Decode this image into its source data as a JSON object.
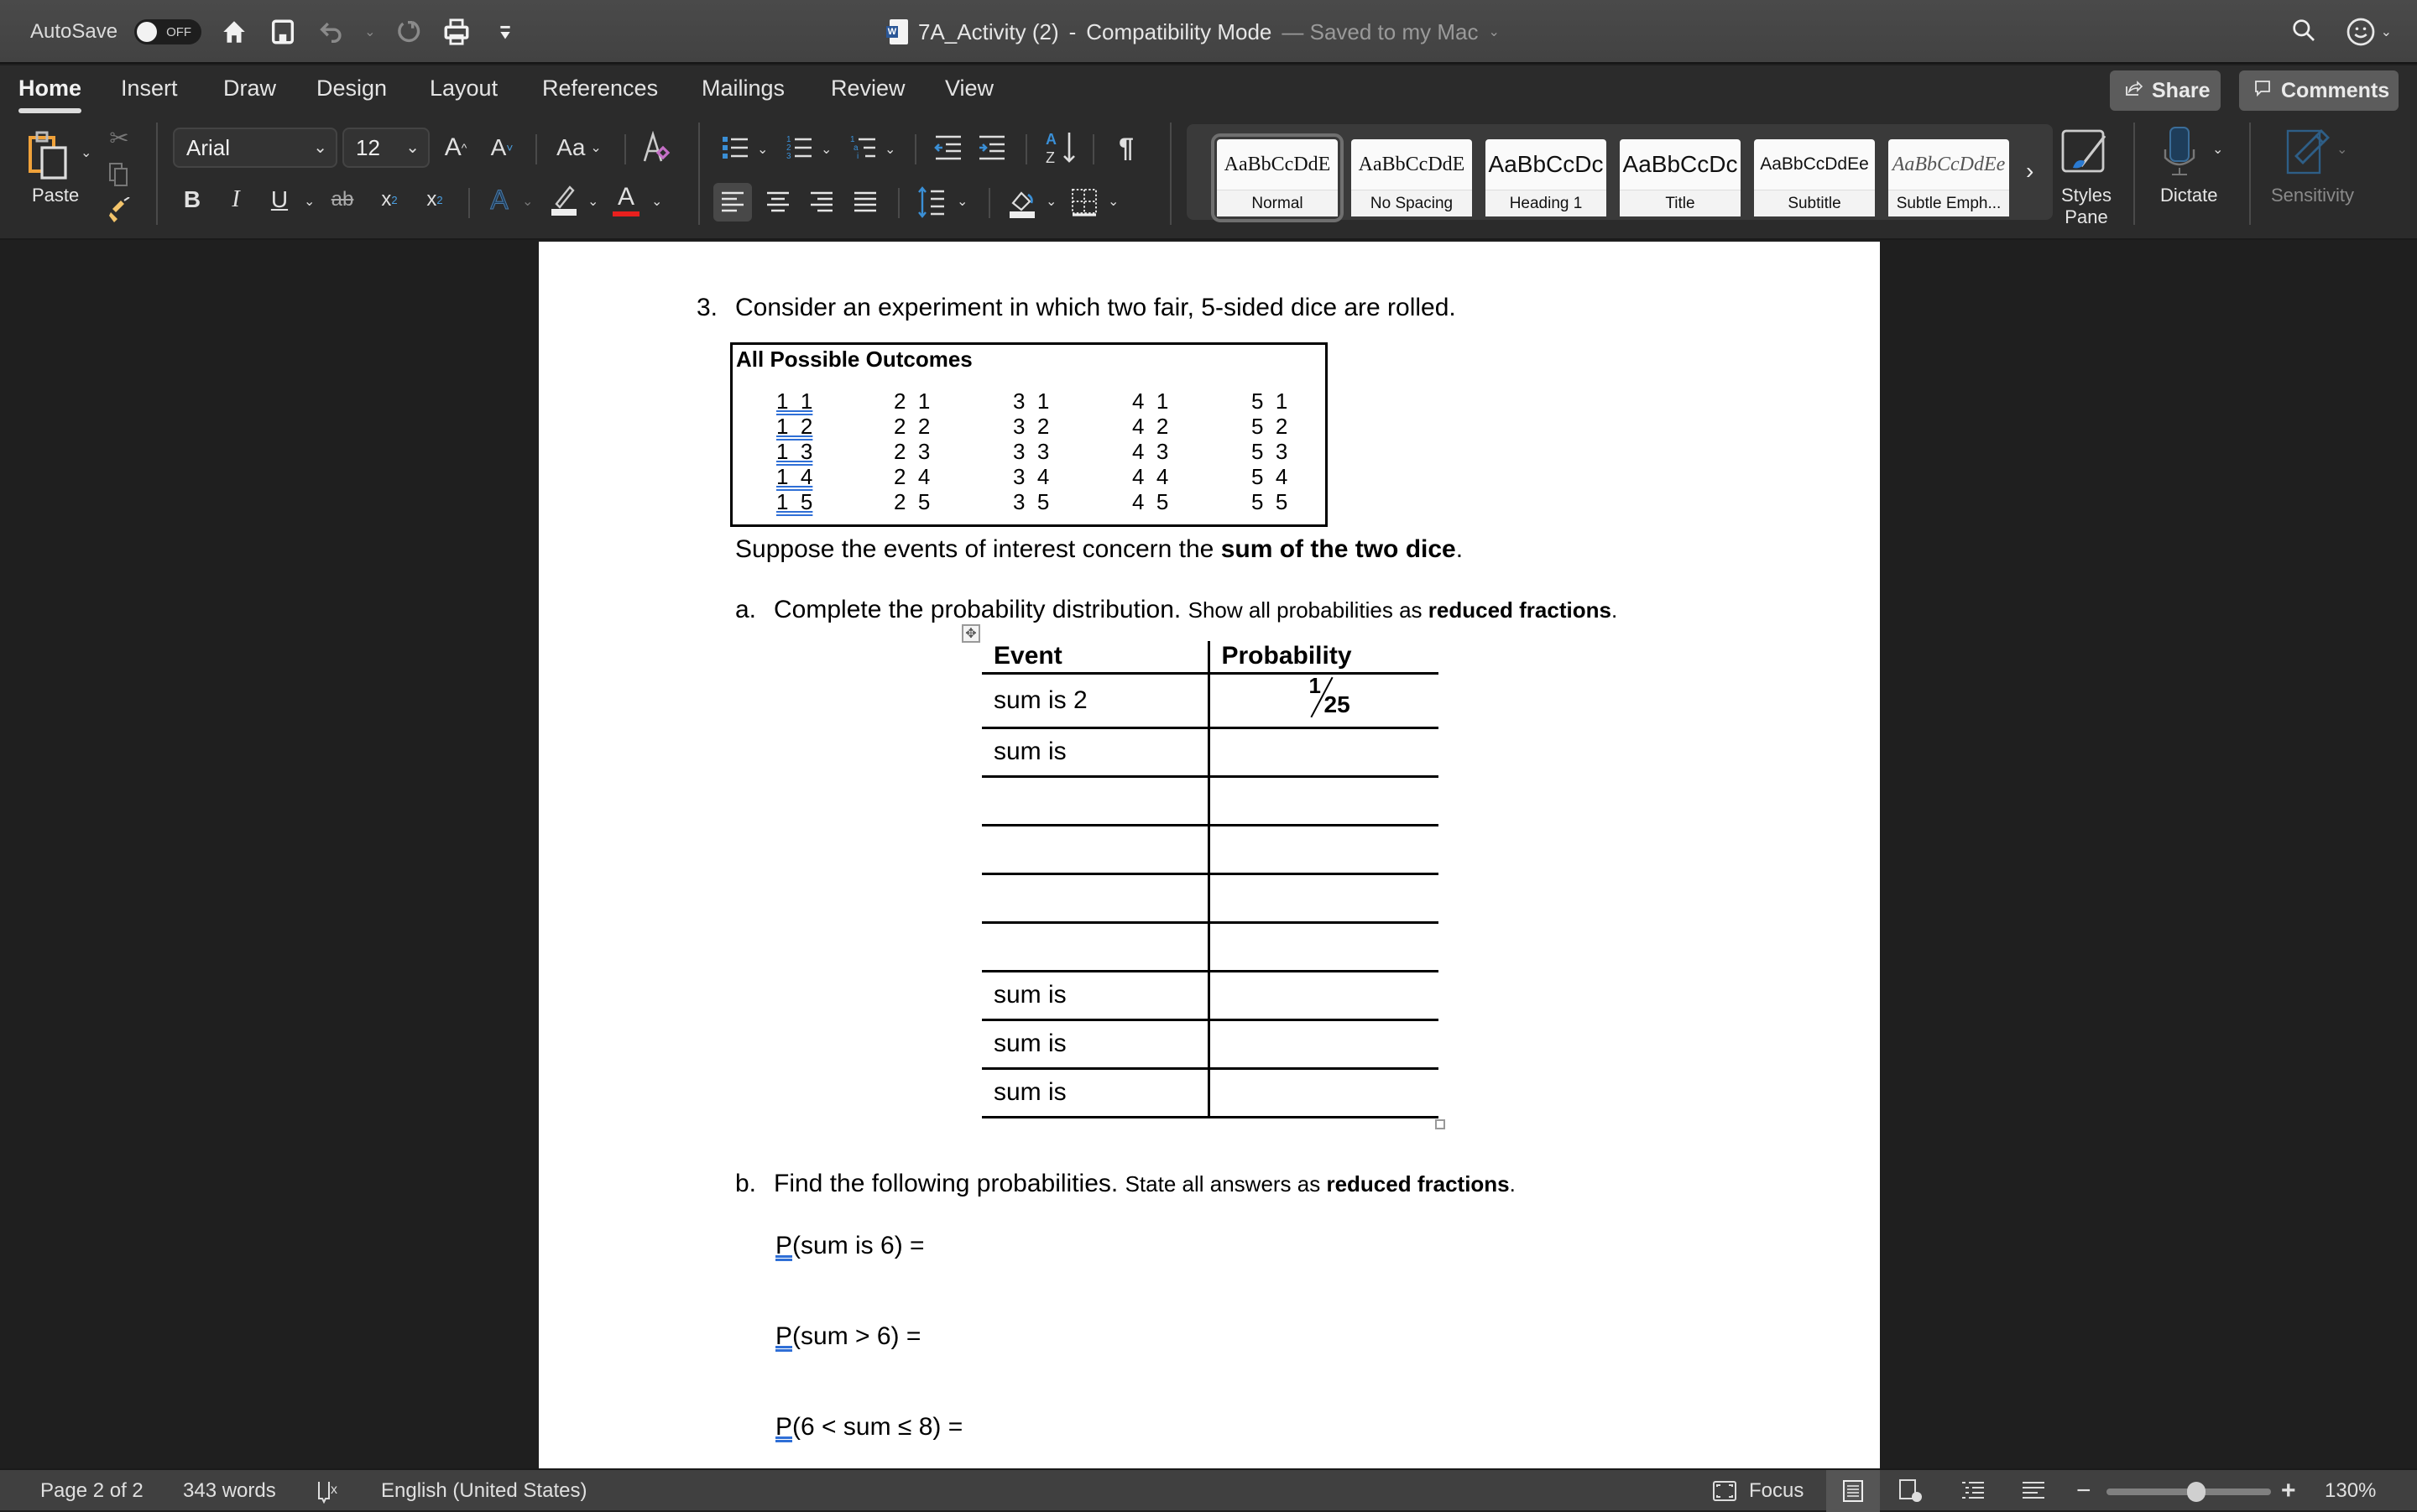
{
  "titlebar": {
    "autosave_label": "AutoSave",
    "autosave_state": "OFF",
    "doc_title": "7A_Activity (2)",
    "separator": "-",
    "mode": "Compatibility Mode",
    "saved_status": "— Saved to my Mac",
    "quick_access": [
      "home-icon",
      "save-icon",
      "undo-icon",
      "redo-icon",
      "print-icon",
      "customize-icon"
    ]
  },
  "ribbon_tabs": [
    {
      "label": "Home",
      "active": true
    },
    {
      "label": "Insert"
    },
    {
      "label": "Draw"
    },
    {
      "label": "Design"
    },
    {
      "label": "Layout"
    },
    {
      "label": "References"
    },
    {
      "label": "Mailings"
    },
    {
      "label": "Review"
    },
    {
      "label": "View"
    }
  ],
  "header_buttons": {
    "share": "Share",
    "comments": "Comments"
  },
  "ribbon": {
    "paste_label": "Paste",
    "font_name": "Arial",
    "font_size": "12",
    "change_case": "Aa",
    "font_color": "#e8201e",
    "highlight_color": "#eeeeee",
    "styles": [
      {
        "preview": "AaBbCcDdE",
        "label": "Normal",
        "selected": true
      },
      {
        "preview": "AaBbCcDdE",
        "label": "No Spacing"
      },
      {
        "preview": "AaBbCcDc",
        "label": "Heading 1"
      },
      {
        "preview": "AaBbCcDc",
        "label": "Title"
      },
      {
        "preview": "AaBbCcDdEe",
        "label": "Subtitle"
      },
      {
        "preview": "AaBbCcDdEe",
        "label": "Subtle Emph..."
      }
    ],
    "styles_pane_label_1": "Styles",
    "styles_pane_label_2": "Pane",
    "dictate_label": "Dictate",
    "sensitivity_label": "Sensitivity"
  },
  "document": {
    "question_number": "3.",
    "question_text": "Consider an experiment in which two fair, 5-sided dice are rolled.",
    "outcomes_title": "All Possible Outcomes",
    "outcomes_columns": [
      [
        "1  1",
        "1  2",
        "1  3",
        "1  4",
        "1  5"
      ],
      [
        "2  1",
        "2  2",
        "2  3",
        "2  4",
        "2  5"
      ],
      [
        "3  1",
        "3  2",
        "3  3",
        "3  4",
        "3  5"
      ],
      [
        "4  1",
        "4  2",
        "4  3",
        "4  4",
        "4  5"
      ],
      [
        "5  1",
        "5  2",
        "5  3",
        "5  4",
        "5  5"
      ]
    ],
    "suppose_text": "Suppose the events of interest concern the ",
    "suppose_bold": "sum of the two dice",
    "suppose_end": ".",
    "part_a": {
      "label": "a.",
      "text": "Complete the probability distribution.",
      "note": "Show all probabilities as ",
      "note_bold": "reduced fractions",
      "note_end": "."
    },
    "dist_table": {
      "headers": [
        "Event",
        "Probability"
      ],
      "rows": [
        {
          "event": "sum is 2",
          "numerator": "1",
          "denominator": "25"
        },
        {
          "event": "sum is",
          "numerator": "",
          "denominator": ""
        },
        {
          "event": "",
          "numerator": "",
          "denominator": ""
        },
        {
          "event": "",
          "numerator": "",
          "denominator": ""
        },
        {
          "event": "",
          "numerator": "",
          "denominator": ""
        },
        {
          "event": "",
          "numerator": "",
          "denominator": ""
        },
        {
          "event": "sum is",
          "numerator": "",
          "denominator": ""
        },
        {
          "event": "sum is",
          "numerator": "",
          "denominator": ""
        },
        {
          "event": "sum is",
          "numerator": "",
          "denominator": ""
        }
      ]
    },
    "part_b": {
      "label": "b.",
      "text": "Find the following probabilities.",
      "note": "State all answers as ",
      "note_bold": "reduced fractions",
      "note_end": ".",
      "items": [
        {
          "p": "P",
          "rest": "(sum is 6) ="
        },
        {
          "p": "P",
          "rest": "(sum > 6) ="
        },
        {
          "p": "P",
          "rest": "(6 < sum ≤ 8) ="
        }
      ]
    }
  },
  "statusbar": {
    "page": "Page 2 of 2",
    "words": "343 words",
    "language": "English (United States)",
    "focus": "Focus",
    "zoom_level": "130%",
    "zoom_fraction": 0.55
  }
}
